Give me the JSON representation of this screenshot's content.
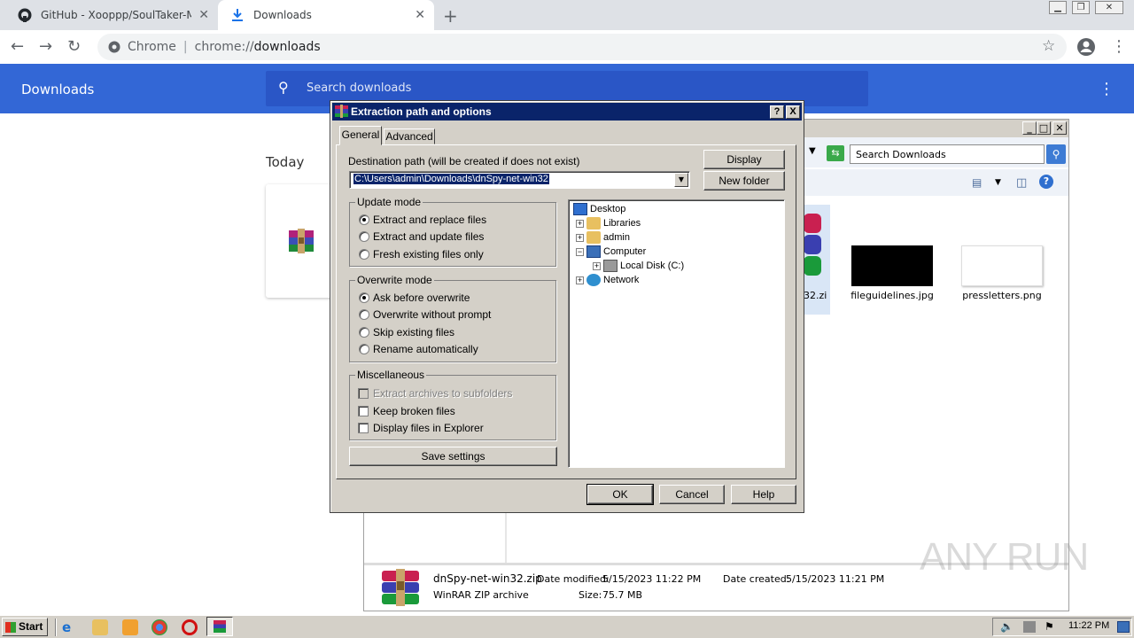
{
  "browser": {
    "tabs": [
      {
        "title": "GitHub - Xooppp/SoulTaker-Multitool"
      },
      {
        "title": "Downloads"
      }
    ],
    "omnibox": {
      "scheme": "Chrome",
      "url_prefix": "chrome://",
      "url_path": "downloads"
    }
  },
  "downloads_page": {
    "title": "Downloads",
    "search_placeholder": "Search downloads",
    "section_today": "Today"
  },
  "explorer": {
    "search_placeholder": "Search Downloads",
    "files": [
      {
        "name": "32.zi"
      },
      {
        "name": "fileguidelines.jpg"
      },
      {
        "name": "pressletters.png"
      }
    ],
    "details": {
      "name": "dnSpy-net-win32.zip",
      "type": "WinRAR ZIP archive",
      "modified_label": "Date modified:",
      "modified_value": "5/15/2023 11:22 PM",
      "created_label": "Date created:",
      "created_value": "5/15/2023 11:21 PM",
      "size_label": "Size:",
      "size_value": "75.7 MB"
    }
  },
  "dialog": {
    "title": "Extraction path and options",
    "help_btn": "?",
    "close_btn": "X",
    "tabs": [
      "General",
      "Advanced"
    ],
    "dest_label": "Destination path (will be created if does not exist)",
    "dest_value": "C:\\Users\\admin\\Downloads\\dnSpy-net-win32",
    "display_btn": "Display",
    "new_folder_btn": "New folder",
    "update_mode": {
      "title": "Update mode",
      "options": [
        "Extract and replace files",
        "Extract and update files",
        "Fresh existing files only"
      ],
      "selected": 0
    },
    "overwrite_mode": {
      "title": "Overwrite mode",
      "options": [
        "Ask before overwrite",
        "Overwrite without prompt",
        "Skip existing files",
        "Rename automatically"
      ],
      "selected": 0
    },
    "misc": {
      "title": "Miscellaneous",
      "options": [
        "Extract archives to subfolders",
        "Keep broken files",
        "Display files in Explorer"
      ]
    },
    "save_settings_btn": "Save settings",
    "tree": [
      "Desktop",
      "Libraries",
      "admin",
      "Computer",
      "Local Disk (C:)",
      "Network"
    ],
    "ok_btn": "OK",
    "cancel_btn": "Cancel",
    "help_btn2": "Help"
  },
  "taskbar": {
    "start": "Start",
    "clock": "11:22 PM"
  },
  "watermark": "ANY RUN",
  "colors": {
    "chrome_blue": "#3367d6",
    "dialog_face": "#d4d0c8",
    "title_bar": "#0a246a"
  }
}
